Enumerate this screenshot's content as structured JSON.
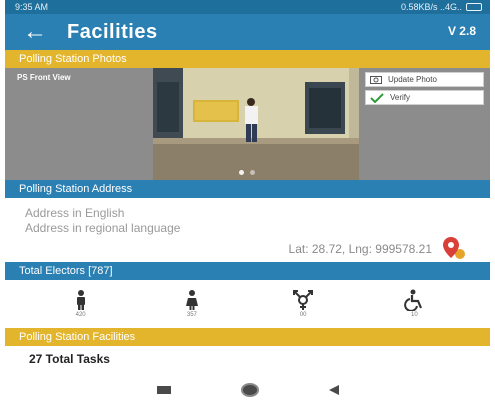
{
  "status_bar": {
    "time": "9:35 AM",
    "network": "0.58KB/s ..4G..",
    "battery_icon": "battery-icon"
  },
  "app_bar": {
    "back_icon": "arrow-left-icon",
    "back_glyph": "←",
    "title": "Facilities",
    "version": "V 2.8"
  },
  "photos_section": {
    "header": "Polling Station Photos",
    "photo_label": "PS Front View",
    "update_photo_label": "Update Photo",
    "verify_label": "Verify"
  },
  "address_section": {
    "header": "Polling Station Address",
    "address_english": "Address in English",
    "address_regional": "Address in regional language",
    "lat_lng": "Lat: 28.72, Lng: 999578.21",
    "location_icon": "map-pin-icon"
  },
  "electors_section": {
    "header": "Total Electors [787]",
    "items": [
      {
        "icon": "male-icon",
        "count": "420"
      },
      {
        "icon": "female-icon",
        "count": "357"
      },
      {
        "icon": "third-gender-icon",
        "count": "00"
      },
      {
        "icon": "wheelchair-icon",
        "count": "10"
      }
    ]
  },
  "facilities_section": {
    "header": "Polling Station Facilities",
    "total_tasks": "27 Total Tasks"
  },
  "colors": {
    "primary_blue": "#2a7fb3",
    "status_blue": "#1e6f9c",
    "accent_yellow": "#e3b52d",
    "verify_check": "#2e9b3a"
  }
}
